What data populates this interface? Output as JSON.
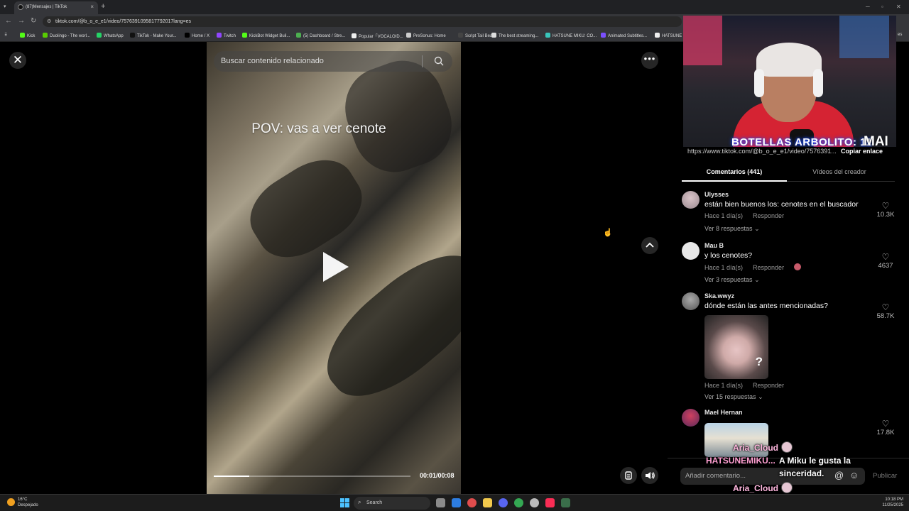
{
  "browser": {
    "tab_title": "(87)Mensajes | TikTok",
    "url": "tiktok.com/@b_o_e_e1/video/7576391095817792017lang=es",
    "bookmarks": [
      {
        "label": "Kick",
        "color": "#53fc18"
      },
      {
        "label": "Duolingo - The worl...",
        "color": "#58cc02"
      },
      {
        "label": "WhatsApp",
        "color": "#25d366"
      },
      {
        "label": "TikTok - Make Your...",
        "color": "#111111"
      },
      {
        "label": "Home / X",
        "color": "#000000"
      },
      {
        "label": "Twitch",
        "color": "#9146ff"
      },
      {
        "label": "KickBot Widget Buil...",
        "color": "#53fc18"
      },
      {
        "label": "(5) Dashboard / Stre...",
        "color": "#4caf50"
      },
      {
        "label": "Popular「VOCALOID...",
        "color": "#eeeeee"
      },
      {
        "label": "PreSonus: Home",
        "color": "#cccccc"
      },
      {
        "label": "Script Tail Beat",
        "color": "#444444"
      },
      {
        "label": "The best streaming...",
        "color": "#dddddd"
      },
      {
        "label": "HATSUNE MIKU: CO...",
        "color": "#39c5bb"
      },
      {
        "label": "Animated Subtitles...",
        "color": "#7b4fff"
      },
      {
        "label": "HATSUNE M",
        "color": "#eeeeee"
      }
    ],
    "extra_bookmarks": "es"
  },
  "video": {
    "search_placeholder": "Buscar contenido relacionado",
    "overlay_text": "POV: vas a ver cenote",
    "time": "00:01/00:08",
    "progress_fraction": 0.18
  },
  "stream": {
    "bottles_label": "BOTELLAS ARBOLITO: 11",
    "brand_label": "MAI"
  },
  "panel": {
    "link_url": "https://www.tiktok.com/@b_o_e_e1/video/7576391...",
    "copy_link": "Copiar enlace",
    "tab_comments": "Comentarios (441)",
    "tab_videos": "Vídeos del creador",
    "comments": [
      {
        "user": "Ulysses",
        "text": "están bien buenos los: cenotes en el buscador",
        "time": "Hace 1 día(s)",
        "reply": "Responder",
        "replies": "Ver 8 respuestas",
        "likes": "10.3K"
      },
      {
        "user": "Mau B",
        "text": "y los cenotes?",
        "time": "Hace 1 día(s)",
        "reply": "Responder",
        "replies": "Ver 3 respuestas",
        "likes": "4637"
      },
      {
        "user": "Ska.wwyz",
        "text": "dónde están las antes mencionadas?",
        "time": "Hace 1 día(s)",
        "reply": "Responder",
        "replies": "Ver 15 respuestas",
        "likes": "58.7K"
      },
      {
        "user": "Mael Hernan",
        "likes": "17.8K"
      }
    ],
    "comment_placeholder": "Añadir comentario...",
    "publish": "Publicar"
  },
  "chat": {
    "line1_name": "Aria_Cloud",
    "line2_name": "HATSUNEMIKU...",
    "line2_msg_a": "A Miku le gusta la",
    "line2_msg_b": "sinceridad.",
    "line3_name": "Aria_Cloud"
  },
  "taskbar": {
    "temp": "16°C",
    "weather": "Despejado",
    "search": "Search",
    "time": "10:18 PM",
    "date": "11/25/2025"
  },
  "icons": [
    "close-icon",
    "more-icon",
    "search-icon",
    "play-icon",
    "chevron-up-icon",
    "captions-icon",
    "volume-icon",
    "heart-icon",
    "at-icon",
    "emoji-icon"
  ]
}
